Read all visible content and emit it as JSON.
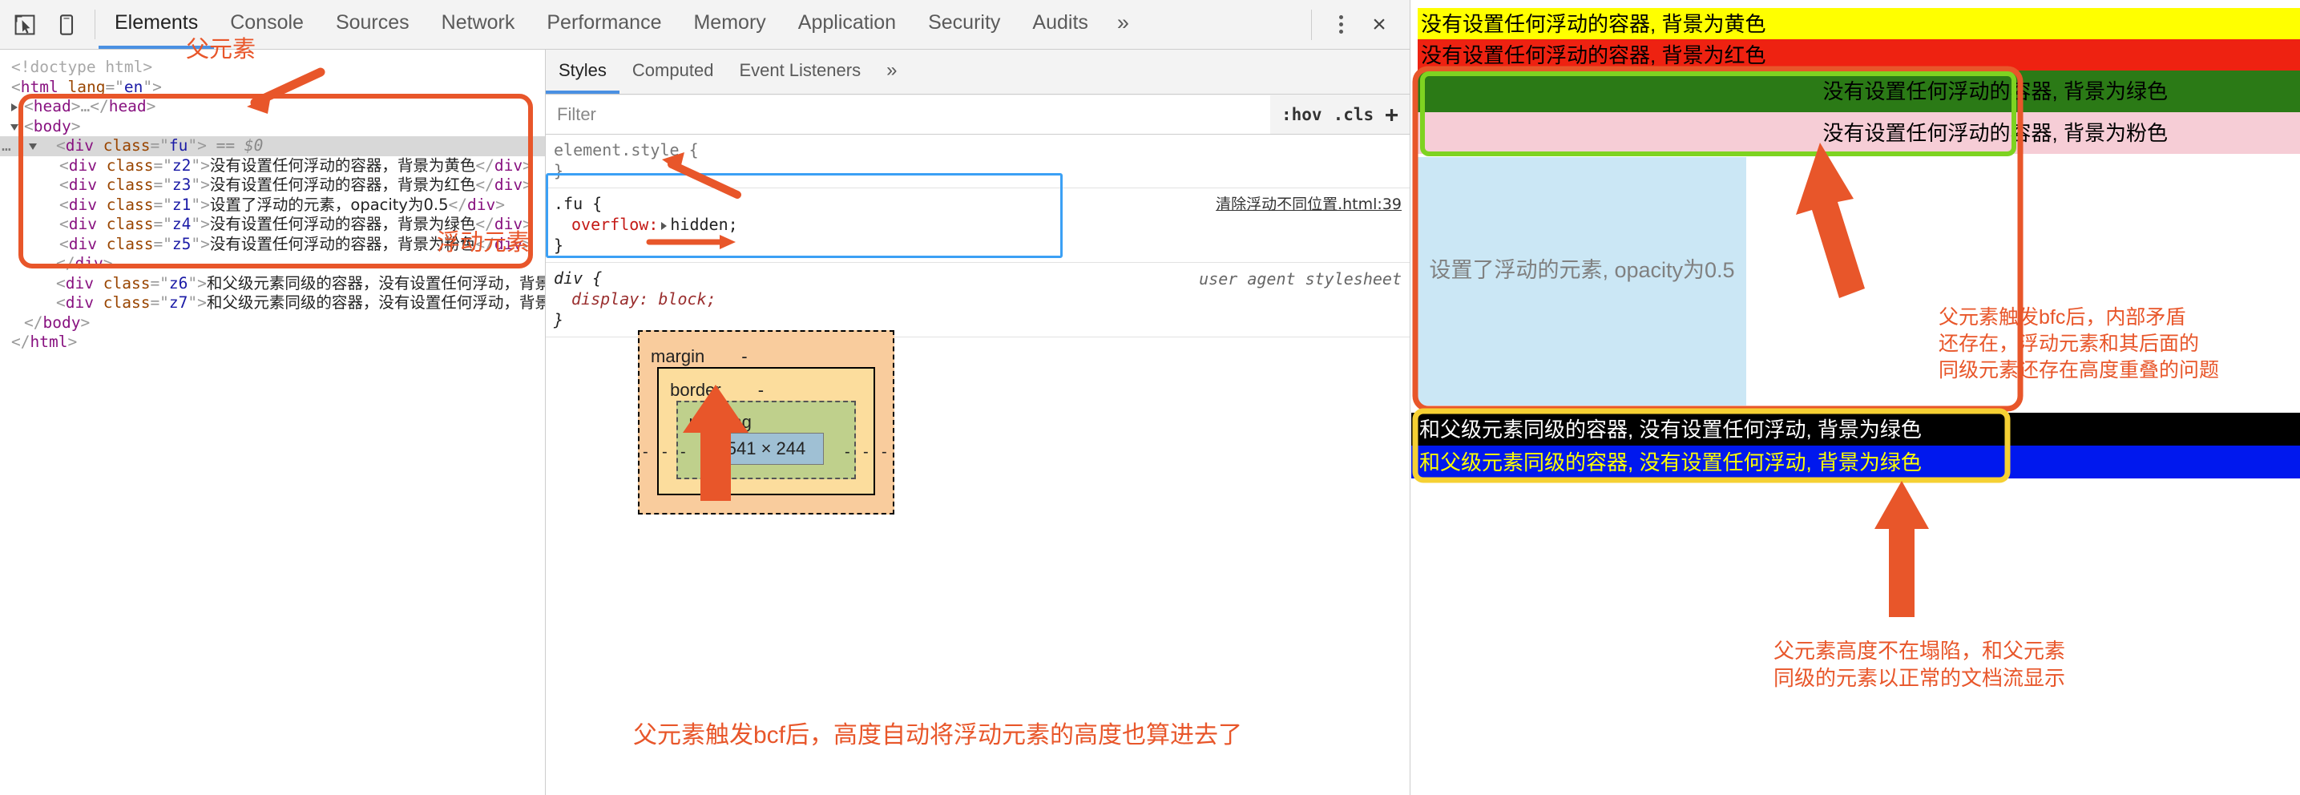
{
  "devtools": {
    "toolbar": {
      "inspect_icon": "inspect-cursor-icon",
      "device_icon": "device-toolbar-icon",
      "tabs": [
        {
          "label": "Elements",
          "active": true
        },
        {
          "label": "Console",
          "active": false
        },
        {
          "label": "Sources",
          "active": false
        },
        {
          "label": "Network",
          "active": false
        },
        {
          "label": "Performance",
          "active": false
        },
        {
          "label": "Memory",
          "active": false
        },
        {
          "label": "Application",
          "active": false
        },
        {
          "label": "Security",
          "active": false
        },
        {
          "label": "Audits",
          "active": false
        },
        {
          "label": "»",
          "active": false
        }
      ],
      "more_label": "»",
      "close_label": "×"
    },
    "dom": {
      "lines": [
        {
          "kind": "doctype",
          "text": "<!doctype html>"
        },
        {
          "kind": "open",
          "tag": "html",
          "attr": "lang",
          "value": "en"
        },
        {
          "kind": "collapsed",
          "tag": "head"
        },
        {
          "kind": "open",
          "tag": "body"
        },
        {
          "kind": "selected",
          "tag": "div",
          "attr": "class",
          "value": "fu",
          "suffix": "== $0"
        },
        {
          "kind": "leaf",
          "tag": "div",
          "attr": "class",
          "value": "z2",
          "text": "没有设置任何浮动的容器，背景为黄色"
        },
        {
          "kind": "leaf",
          "tag": "div",
          "attr": "class",
          "value": "z3",
          "text": "没有设置任何浮动的容器，背景为红色"
        },
        {
          "kind": "leaf",
          "tag": "div",
          "attr": "class",
          "value": "z1",
          "text": "设置了浮动的元素，opacity为0.5"
        },
        {
          "kind": "leaf",
          "tag": "div",
          "attr": "class",
          "value": "z4",
          "text": "没有设置任何浮动的容器，背景为绿色"
        },
        {
          "kind": "leaf",
          "tag": "div",
          "attr": "class",
          "value": "z5",
          "text": "没有设置任何浮动的容器，背景为粉色"
        },
        {
          "kind": "close",
          "tag": "div"
        },
        {
          "kind": "leaf",
          "tag": "div",
          "attr": "class",
          "value": "z6",
          "text": "和父级元素同级的容器，没有设置任何浮动，背景为绿色"
        },
        {
          "kind": "leaf",
          "tag": "div",
          "attr": "class",
          "value": "z7",
          "text": "和父级元素同级的容器，没有设置任何浮动，背景为绿色"
        },
        {
          "kind": "close",
          "tag": "body"
        },
        {
          "kind": "close",
          "tag": "html"
        }
      ]
    },
    "styles": {
      "tabs": [
        {
          "label": "Styles",
          "active": true
        },
        {
          "label": "Computed",
          "active": false
        },
        {
          "label": "Event Listeners",
          "active": false
        },
        {
          "label": "»",
          "active": false
        }
      ],
      "filter_placeholder": "Filter",
      "hov_label": ":hov",
      "cls_label": ".cls",
      "add_label": "+",
      "rules": [
        {
          "selector": "element.style {",
          "close": "}",
          "source": "",
          "declarations": []
        },
        {
          "selector": ".fu {",
          "close": "}",
          "source": "清除浮动不同位置.html:39",
          "declarations": [
            {
              "prop": "overflow:",
              "value": "hidden;"
            }
          ]
        },
        {
          "selector": "div {",
          "close": "}",
          "source": "user agent stylesheet",
          "declarations": [
            {
              "prop": "display:",
              "value": "block;"
            }
          ]
        }
      ],
      "box_model": {
        "margin_label": "margin",
        "margin_value": "-",
        "border_label": "border",
        "border_value": "-",
        "padding_label": "padding",
        "content_size": "541 × 244",
        "dash": "-"
      }
    }
  },
  "viewport": {
    "rows": [
      {
        "name": "z2",
        "text": "没有设置任何浮动的容器, 背景为黄色",
        "bg": "#ffff00",
        "color": "#000000",
        "align": "left"
      },
      {
        "name": "z3",
        "text": "没有设置任何浮动的容器, 背景为红色",
        "bg": "#ee2211",
        "color": "#000000",
        "align": "left"
      },
      {
        "name": "z4",
        "text": "没有设置任何浮动的容器, 背景为绿色",
        "bg": "#2b7a16",
        "color": "#000000",
        "align": "right"
      },
      {
        "name": "z5",
        "text": "没有设置任何浮动的容器, 背景为粉色",
        "bg": "#f6cdd6",
        "color": "#000000",
        "align": "right"
      },
      {
        "name": "z1",
        "text": "设置了浮动的元素, opacity为0.5",
        "bg": "#cbe7f5",
        "color": "#808080",
        "align": "center"
      },
      {
        "name": "z6",
        "text": "和父级元素同级的容器, 没有设置任何浮动, 背景为绿色",
        "bg": "#000000",
        "color": "#ffffff",
        "align": "left"
      },
      {
        "name": "z7",
        "text": "和父级元素同级的容器, 没有设置任何浮动, 背景为绿色",
        "bg": "#0018ee",
        "color": "#ffff00",
        "align": "left"
      }
    ]
  },
  "annotations": {
    "accent": "#e8562a",
    "parent_element": "父元素",
    "float_element": "浮动元素",
    "bfc_inner": "父元素触发bfc后，内部矛盾\n还存在，浮动元素和其后面的\n同级元素还存在高度重叠的问题",
    "no_collapse": "父元素高度不在塌陷，和父元素\n同级的元素以正常的文档流显示",
    "box_caption": "父元素触发bcf后，高度自动将浮动元素的高度也算进去了"
  }
}
